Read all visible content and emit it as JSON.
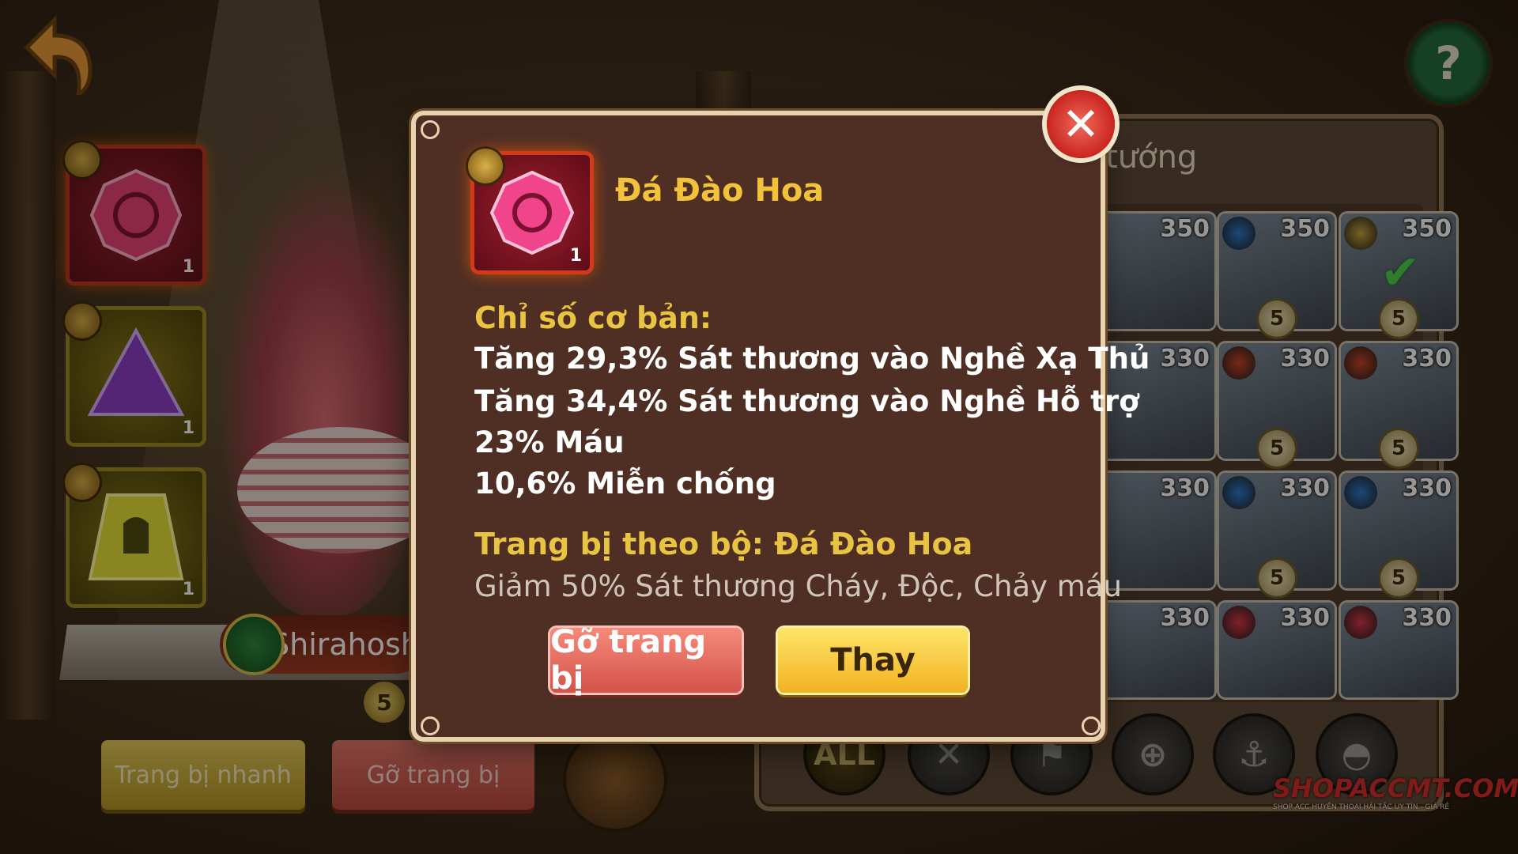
{
  "background": {
    "hero_name": "Shirahoshi",
    "hero_stars": "5",
    "quick_equip_label": "Trang bị nhanh",
    "unequip_label": "Gỡ trang bị",
    "panel_title": "h tướng",
    "slots": [
      {
        "level": "1",
        "icon": "fire-gem-icon",
        "color": "#e8407a"
      },
      {
        "level": "1",
        "icon": "triangle-gem-icon",
        "color": "#8a3ac8"
      },
      {
        "level": "1",
        "icon": "helmet-gem-icon",
        "color": "#e6e23a"
      }
    ],
    "heroes": [
      {
        "power": "350",
        "stars": "",
        "class_icon": ""
      },
      {
        "power": "350",
        "stars": "5",
        "class_icon": "water-class-icon"
      },
      {
        "power": "350",
        "stars": "5",
        "class_icon": "gold-class-icon",
        "selected": true
      },
      {
        "power": "330",
        "stars": "",
        "class_icon": ""
      },
      {
        "power": "330",
        "stars": "5",
        "class_icon": "fist-class-icon"
      },
      {
        "power": "330",
        "stars": "5",
        "class_icon": "fist-class-icon"
      },
      {
        "power": "330",
        "stars": "",
        "class_icon": ""
      },
      {
        "power": "330",
        "stars": "5",
        "class_icon": "water-class-icon"
      },
      {
        "power": "330",
        "stars": "5",
        "class_icon": "water-class-icon"
      },
      {
        "power": "330",
        "stars": "",
        "class_icon": ""
      },
      {
        "power": "330",
        "stars": "",
        "class_icon": "heart-class-icon"
      },
      {
        "power": "330",
        "stars": "",
        "class_icon": "heart-class-icon"
      }
    ],
    "filters": [
      "ALL",
      "sword-filter-icon",
      "flag-filter-icon",
      "target-filter-icon",
      "anchor-filter-icon",
      "helmet-filter-icon"
    ],
    "watermark": {
      "title": "SHOPACCMT.COM",
      "subtitle": "SHOP ACC HUYỀN THOẠI HẢI TẶC UY TÍN - GIÁ RẺ"
    }
  },
  "modal": {
    "gem": {
      "name": "Đá Đào Hoa",
      "level": "1",
      "icon": "peach-gem-icon",
      "color": "#f0458a"
    },
    "base_stats_title": "Chỉ số cơ bản:",
    "stats": [
      "Tăng 29,3% Sát thương vào Nghề Xạ Thủ",
      "Tăng 34,4% Sát thương vào Nghề Hỗ trợ",
      "23% Máu",
      "10,6% Miễn chống"
    ],
    "set_title": "Trang bị theo bộ: Đá Đào Hoa",
    "set_desc": "Giảm 50% Sát thương Cháy, Độc, Chảy máu",
    "remove_label": "Gỡ trang bị",
    "replace_label": "Thay",
    "close_icon": "close-icon"
  }
}
